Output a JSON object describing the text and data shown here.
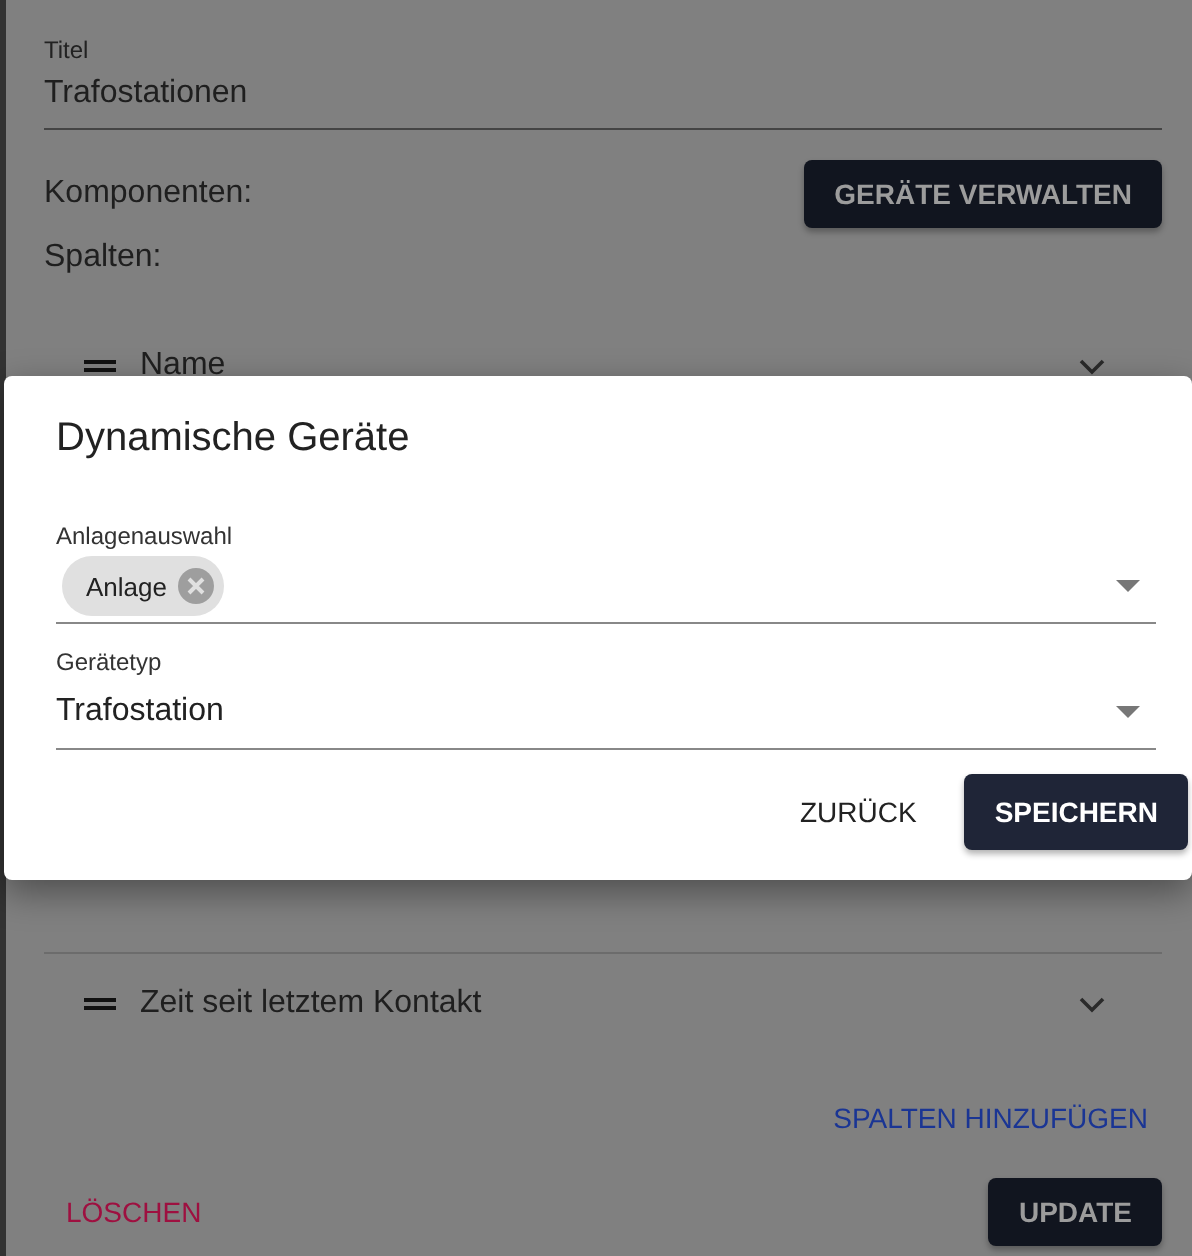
{
  "form": {
    "title_field": {
      "label": "Titel",
      "value": "Trafostationen"
    },
    "components_label": "Komponenten:",
    "manage_button": "GERÄTE VERWALTEN",
    "columns_label": "Spalten:",
    "columns": [
      {
        "name": "Name"
      },
      {
        "name": "Zeit seit letztem Kontakt"
      }
    ],
    "add_columns_link": "SPALTEN HINZUFÜGEN",
    "delete_button": "LÖSCHEN",
    "update_button": "UPDATE"
  },
  "dialog": {
    "title": "Dynamische Geräte",
    "fields": [
      {
        "kind": "chips",
        "label": "Anlagenauswahl",
        "chips": [
          "Anlage"
        ]
      },
      {
        "kind": "select",
        "label": "Gerätetyp",
        "value": "Trafostation"
      }
    ],
    "buttons": [
      {
        "label": "ZURÜCK",
        "kind": "text"
      },
      {
        "label": "SPEICHERN",
        "kind": "primary"
      }
    ]
  }
}
